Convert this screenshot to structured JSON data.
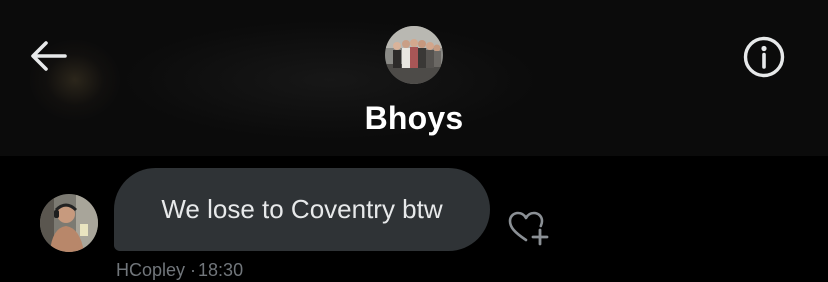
{
  "header": {
    "group_name": "Bhoys",
    "back_icon": "arrow-left-icon",
    "info_icon": "info-circle-icon",
    "group_avatar": "group-photo"
  },
  "messages": [
    {
      "sender": "HCopley",
      "time": "18:30",
      "separator": "·",
      "text": "We lose to Coventry btw",
      "avatar": "sender-photo",
      "reaction_icon": "heart-plus-icon"
    }
  ],
  "colors": {
    "background": "#000000",
    "header_background": "#0b0b0b",
    "bubble": "#2f3336",
    "text": "#e7e9ea",
    "meta_text": "#71767b"
  }
}
